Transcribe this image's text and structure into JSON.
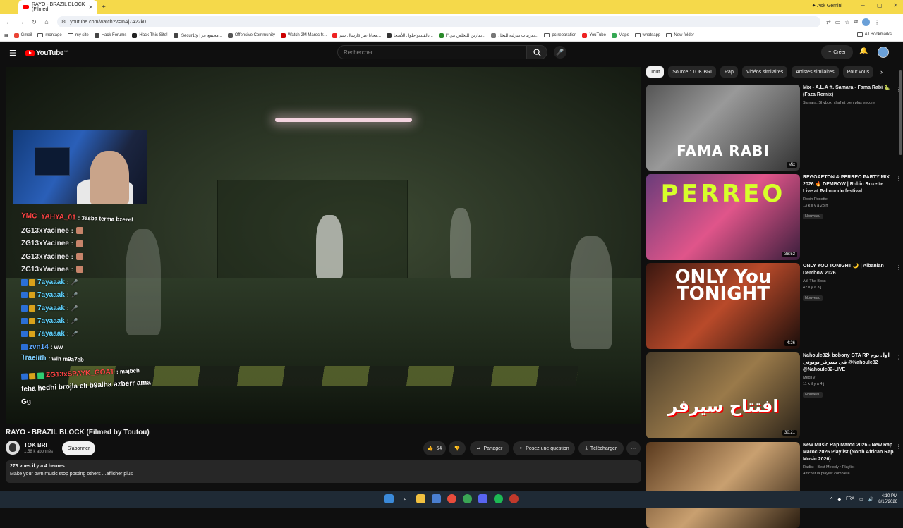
{
  "browser": {
    "tab_title": "RAYO - BRAZIL BLOCK (Filmed",
    "gemini": "Ask Gemini",
    "url": "youtube.com/watch?v=InAj7A22k0",
    "bookmarks": [
      "Gmail",
      "montage",
      "my site",
      "Hack Forums",
      "Hack This Site!",
      "iSecur1ty | مجتمع عر...",
      "Offensive Community",
      "Watch 2M Maroc fr...",
      "ارسال سمs مجانا عبر...",
      "بالفيديو:حلول للأصحا...",
      "تمارين للتخلص من \"ا...",
      "تمرينات منزلية للتخل...",
      "pc reparation",
      "YouTube",
      "Maps",
      "whatsapp",
      "New folder"
    ],
    "all_bookmarks": "All Bookmarks"
  },
  "youtube": {
    "logo": "YouTube",
    "logo_country": "MA",
    "search_placeholder": "Rechercher",
    "create": "Créer"
  },
  "chat": [
    {
      "user": "YMC_YAHYA_01",
      "msg": ": 3asba terma bzezel",
      "color": "#ff4444",
      "badges": 0
    },
    {
      "user": "ZG13xYacinee",
      "msg": ":",
      "color": "#e8e8e8",
      "badges": 0,
      "emote": true
    },
    {
      "user": "ZG13xYacinee",
      "msg": ":",
      "color": "#e8e8e8",
      "badges": 0,
      "emote": true
    },
    {
      "user": "ZG13xYacinee",
      "msg": ":",
      "color": "#e8e8e8",
      "badges": 0,
      "emote": true
    },
    {
      "user": "ZG13xYacinee",
      "msg": ":",
      "color": "#e8e8e8",
      "badges": 0,
      "emote": true
    },
    {
      "user": "7ayaaak",
      "msg": ":",
      "color": "#5fd3ff",
      "badges": 2
    },
    {
      "user": "7ayaaak",
      "msg": ":",
      "color": "#5fd3ff",
      "badges": 2
    },
    {
      "user": "7ayaaak",
      "msg": ":",
      "color": "#5fd3ff",
      "badges": 2
    },
    {
      "user": "7ayaaak",
      "msg": ":",
      "color": "#5fd3ff",
      "badges": 2
    },
    {
      "user": "7ayaaak",
      "msg": ":",
      "color": "#5fd3ff",
      "badges": 2
    },
    {
      "user": "zvn14",
      "msg": ": ww",
      "color": "#5fa8ff",
      "badges": 1
    },
    {
      "user": "Traelith",
      "msg": ": wlh m9a7eb",
      "color": "#7fd0ff",
      "badges": 0
    },
    {
      "user": "ZG13xSPAYK_GOAT",
      "msg": ": majbch",
      "color": "#ff4444",
      "badges": 3
    },
    {
      "user": "feha hedhi brojla eli b9alha azberr ama",
      "msg": "",
      "color": "#ffffff",
      "badges": 0
    },
    {
      "user": "Gg",
      "msg": "",
      "color": "#ffffff",
      "badges": 0
    }
  ],
  "video": {
    "title": "RAYO - BRAZIL BLOCK (Filmed by Toutou)",
    "channel": "TOK BRI",
    "subscribers": "1,58 k abonnés",
    "subscribe": "S'abonner",
    "likes": "64",
    "share": "Partager",
    "ask": "Posez une question",
    "download": "Télécharger",
    "views": "273 vues  il y a 4 heures",
    "description": "Make your own music stop posting others ...afficher plus"
  },
  "chips": [
    "Tout",
    "Source : TOK BRI",
    "Rap",
    "Vidéos similaires",
    "Artistes similaires",
    "Pour vous"
  ],
  "recommendations": [
    {
      "title": "Mix - A.L.A ft. Samara - Fama Rabi 🐍 (Faza Remix)",
      "channel": "Samara, Shvbbx, chaf et bien plus encore",
      "meta": "",
      "duration": "Mix",
      "thumb_text": "FAMA RABI",
      "is_new": false
    },
    {
      "title": "REGGAETON & PERREO PARTY MIX 2026 🔥 DEMBOW | Robin Roxette Live at Palmundo festival",
      "channel": "Robin Roxette",
      "meta": "13 k  il y a 23 h",
      "duration": "38:52",
      "thumb_text": "PERREO",
      "is_new": true
    },
    {
      "title": "ONLY YOU TONIGHT 🌙 | Albanian Dembow 2026",
      "channel": "Adi The Boss",
      "meta": "42  il y a 3 j",
      "duration": "4:26",
      "thumb_text": "ONLY You TONIGHT",
      "is_new": true
    },
    {
      "title": "Nahoule82k bobony GTA RP اول يوم في سيرفر بوبوني @Nahoule82 @Nahoule82-LIVE",
      "channel": "MedTV",
      "meta": "11 k  il y a 4 j",
      "duration": "30:21",
      "thumb_text": "افتتاح سيرفر",
      "is_new": true
    },
    {
      "title": "New Music Rap Maroc 2026 - New Rap Maroc 2026 Playlist (North African Rap Music 2026)",
      "channel": "Radist - Best Melody • Playlist",
      "meta": "Afficher la playlist complète",
      "duration": "",
      "thumb_text": "",
      "is_new": false
    }
  ],
  "new_label": "Nouveau",
  "taskbar": {
    "lang": "FRA",
    "time": "4:10 PM",
    "date": "8/15/2026"
  }
}
